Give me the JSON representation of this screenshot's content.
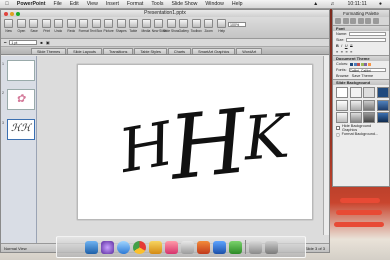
{
  "menubar": {
    "apple": "",
    "app": "PowerPoint",
    "items": [
      "File",
      "Edit",
      "View",
      "Insert",
      "Format",
      "Tools",
      "Slide Show",
      "Window",
      "Help"
    ],
    "time": "10:11:11"
  },
  "window": {
    "title": "Presentation1.pptx"
  },
  "toolbar": [
    {
      "label": "New"
    },
    {
      "label": "Open"
    },
    {
      "label": "Save"
    },
    {
      "label": "Print"
    },
    {
      "label": "Undo"
    },
    {
      "label": "Redo"
    },
    {
      "label": "Format"
    },
    {
      "label": "Text Box"
    },
    {
      "label": "Picture"
    },
    {
      "label": "Shapes"
    },
    {
      "label": "Table"
    },
    {
      "label": "Media"
    },
    {
      "label": "New Slide"
    },
    {
      "label": "Slide Show"
    },
    {
      "label": "Gallery"
    },
    {
      "label": "Toolbox"
    },
    {
      "label": "Zoom"
    },
    {
      "label": "Help"
    }
  ],
  "zoom": "100%",
  "format": {
    "size": "1 pt"
  },
  "ribbon": [
    "Slide Themes",
    "Slide Layouts",
    "Transitions",
    "Table Styles",
    "Charts",
    "SmartArt Graphics",
    "WordArt"
  ],
  "slides": [
    {
      "num": "1"
    },
    {
      "num": "2"
    },
    {
      "num": "3"
    }
  ],
  "monogram": {
    "left": "H",
    "center": "H",
    "right": "K"
  },
  "status": {
    "view": "Normal View",
    "slide": "Slide 3 of 3"
  },
  "toolbox": {
    "title": "Formatting Palette",
    "font": "Font",
    "name_label": "Name:",
    "size_label": "Size:",
    "doc_theme": "Document Theme",
    "colors_label": "Colors:",
    "fonts_label": "Fonts:",
    "fonts_value": "Calibri, Calibri",
    "browse": "Browse",
    "save_theme": "Save Theme",
    "slide_bg": "Slide Background",
    "hide_bg": "Hide Background Graphics",
    "format_bg": "Format Background..."
  },
  "colors": {
    "accent": "#3a6fb0",
    "desktop": "#9a3524",
    "slide_bg": "#ffffff"
  }
}
